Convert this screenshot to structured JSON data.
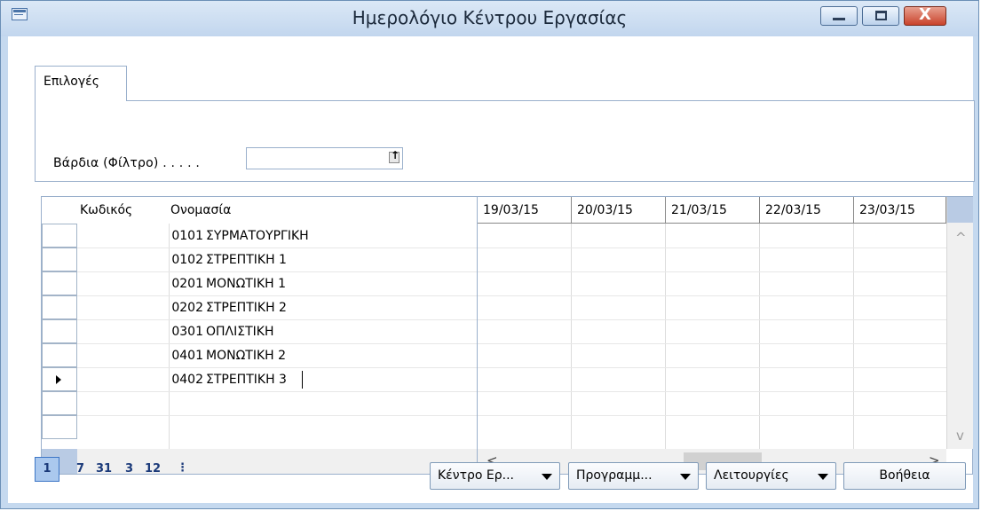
{
  "window": {
    "title": "Ημερολόγιο Κέντρου Εργασίας",
    "minimize_icon": "minimize-icon",
    "maximize_icon": "maximize-icon",
    "close_label": "X"
  },
  "tabs": [
    {
      "label": "Επιλογές"
    }
  ],
  "filter": {
    "label": "Βάρδια (Φίλτρο) . . . . .",
    "value": "",
    "lookup_icon": "arrow-up-icon"
  },
  "grid": {
    "headers": {
      "code": "Κωδικός",
      "name": "Ονομασία"
    },
    "dates": [
      "19/03/15",
      "20/03/15",
      "21/03/15",
      "22/03/15",
      "23/03/15"
    ],
    "rows": [
      {
        "code": "0101",
        "name": "ΣΥΡΜΑΤΟΥΡΓΙΚΗ"
      },
      {
        "code": "0102",
        "name": "ΣΤΡΕΠΤΙΚΗ 1"
      },
      {
        "code": "0201",
        "name": "ΜΟΝΩΤΙΚΗ 1"
      },
      {
        "code": "0202",
        "name": "ΣΤΡΕΠΤΙΚΗ 2"
      },
      {
        "code": "0301",
        "name": "ΟΠΛΙΣΤΙΚΗ"
      },
      {
        "code": "0401",
        "name": "ΜΟΝΩΤΙΚΗ 2"
      },
      {
        "code": "0402",
        "name": "ΣΤΡΕΠΤΙΚΗ 3"
      }
    ],
    "selected_row": 7,
    "scroll_left": "<",
    "scroll_right": ">",
    "scroll_up": "^",
    "scroll_down": "v"
  },
  "periods": [
    "1",
    "7",
    "31",
    "3",
    "12",
    "⋮"
  ],
  "buttons": {
    "work_center": "Κέντρο Ερ...",
    "schedule": "Προγραμμ...",
    "functions": "Λειτουργίες",
    "help": "Βοήθεια"
  }
}
